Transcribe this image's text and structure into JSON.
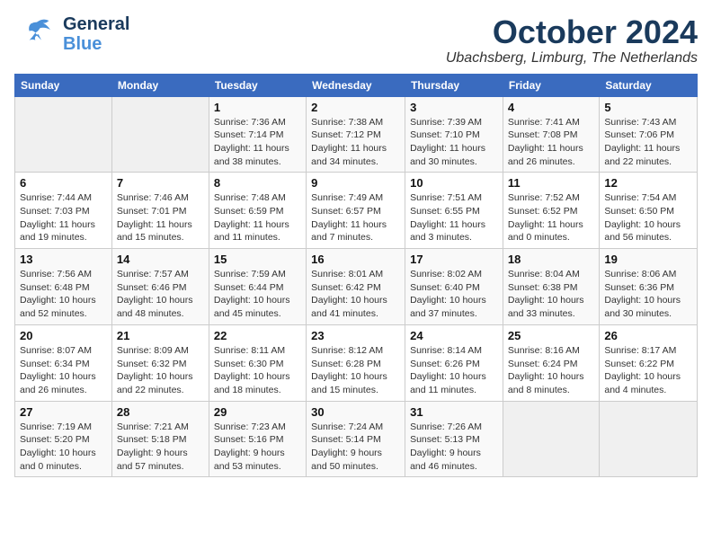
{
  "logo": {
    "general": "General",
    "blue": "Blue"
  },
  "header": {
    "month": "October 2024",
    "location": "Ubachsberg, Limburg, The Netherlands"
  },
  "weekdays": [
    "Sunday",
    "Monday",
    "Tuesday",
    "Wednesday",
    "Thursday",
    "Friday",
    "Saturday"
  ],
  "weeks": [
    [
      {
        "day": "",
        "empty": true
      },
      {
        "day": "",
        "empty": true
      },
      {
        "day": "1",
        "sunrise": "Sunrise: 7:36 AM",
        "sunset": "Sunset: 7:14 PM",
        "daylight": "Daylight: 11 hours and 38 minutes."
      },
      {
        "day": "2",
        "sunrise": "Sunrise: 7:38 AM",
        "sunset": "Sunset: 7:12 PM",
        "daylight": "Daylight: 11 hours and 34 minutes."
      },
      {
        "day": "3",
        "sunrise": "Sunrise: 7:39 AM",
        "sunset": "Sunset: 7:10 PM",
        "daylight": "Daylight: 11 hours and 30 minutes."
      },
      {
        "day": "4",
        "sunrise": "Sunrise: 7:41 AM",
        "sunset": "Sunset: 7:08 PM",
        "daylight": "Daylight: 11 hours and 26 minutes."
      },
      {
        "day": "5",
        "sunrise": "Sunrise: 7:43 AM",
        "sunset": "Sunset: 7:06 PM",
        "daylight": "Daylight: 11 hours and 22 minutes."
      }
    ],
    [
      {
        "day": "6",
        "sunrise": "Sunrise: 7:44 AM",
        "sunset": "Sunset: 7:03 PM",
        "daylight": "Daylight: 11 hours and 19 minutes."
      },
      {
        "day": "7",
        "sunrise": "Sunrise: 7:46 AM",
        "sunset": "Sunset: 7:01 PM",
        "daylight": "Daylight: 11 hours and 15 minutes."
      },
      {
        "day": "8",
        "sunrise": "Sunrise: 7:48 AM",
        "sunset": "Sunset: 6:59 PM",
        "daylight": "Daylight: 11 hours and 11 minutes."
      },
      {
        "day": "9",
        "sunrise": "Sunrise: 7:49 AM",
        "sunset": "Sunset: 6:57 PM",
        "daylight": "Daylight: 11 hours and 7 minutes."
      },
      {
        "day": "10",
        "sunrise": "Sunrise: 7:51 AM",
        "sunset": "Sunset: 6:55 PM",
        "daylight": "Daylight: 11 hours and 3 minutes."
      },
      {
        "day": "11",
        "sunrise": "Sunrise: 7:52 AM",
        "sunset": "Sunset: 6:52 PM",
        "daylight": "Daylight: 11 hours and 0 minutes."
      },
      {
        "day": "12",
        "sunrise": "Sunrise: 7:54 AM",
        "sunset": "Sunset: 6:50 PM",
        "daylight": "Daylight: 10 hours and 56 minutes."
      }
    ],
    [
      {
        "day": "13",
        "sunrise": "Sunrise: 7:56 AM",
        "sunset": "Sunset: 6:48 PM",
        "daylight": "Daylight: 10 hours and 52 minutes."
      },
      {
        "day": "14",
        "sunrise": "Sunrise: 7:57 AM",
        "sunset": "Sunset: 6:46 PM",
        "daylight": "Daylight: 10 hours and 48 minutes."
      },
      {
        "day": "15",
        "sunrise": "Sunrise: 7:59 AM",
        "sunset": "Sunset: 6:44 PM",
        "daylight": "Daylight: 10 hours and 45 minutes."
      },
      {
        "day": "16",
        "sunrise": "Sunrise: 8:01 AM",
        "sunset": "Sunset: 6:42 PM",
        "daylight": "Daylight: 10 hours and 41 minutes."
      },
      {
        "day": "17",
        "sunrise": "Sunrise: 8:02 AM",
        "sunset": "Sunset: 6:40 PM",
        "daylight": "Daylight: 10 hours and 37 minutes."
      },
      {
        "day": "18",
        "sunrise": "Sunrise: 8:04 AM",
        "sunset": "Sunset: 6:38 PM",
        "daylight": "Daylight: 10 hours and 33 minutes."
      },
      {
        "day": "19",
        "sunrise": "Sunrise: 8:06 AM",
        "sunset": "Sunset: 6:36 PM",
        "daylight": "Daylight: 10 hours and 30 minutes."
      }
    ],
    [
      {
        "day": "20",
        "sunrise": "Sunrise: 8:07 AM",
        "sunset": "Sunset: 6:34 PM",
        "daylight": "Daylight: 10 hours and 26 minutes."
      },
      {
        "day": "21",
        "sunrise": "Sunrise: 8:09 AM",
        "sunset": "Sunset: 6:32 PM",
        "daylight": "Daylight: 10 hours and 22 minutes."
      },
      {
        "day": "22",
        "sunrise": "Sunrise: 8:11 AM",
        "sunset": "Sunset: 6:30 PM",
        "daylight": "Daylight: 10 hours and 18 minutes."
      },
      {
        "day": "23",
        "sunrise": "Sunrise: 8:12 AM",
        "sunset": "Sunset: 6:28 PM",
        "daylight": "Daylight: 10 hours and 15 minutes."
      },
      {
        "day": "24",
        "sunrise": "Sunrise: 8:14 AM",
        "sunset": "Sunset: 6:26 PM",
        "daylight": "Daylight: 10 hours and 11 minutes."
      },
      {
        "day": "25",
        "sunrise": "Sunrise: 8:16 AM",
        "sunset": "Sunset: 6:24 PM",
        "daylight": "Daylight: 10 hours and 8 minutes."
      },
      {
        "day": "26",
        "sunrise": "Sunrise: 8:17 AM",
        "sunset": "Sunset: 6:22 PM",
        "daylight": "Daylight: 10 hours and 4 minutes."
      }
    ],
    [
      {
        "day": "27",
        "sunrise": "Sunrise: 7:19 AM",
        "sunset": "Sunset: 5:20 PM",
        "daylight": "Daylight: 10 hours and 0 minutes."
      },
      {
        "day": "28",
        "sunrise": "Sunrise: 7:21 AM",
        "sunset": "Sunset: 5:18 PM",
        "daylight": "Daylight: 9 hours and 57 minutes."
      },
      {
        "day": "29",
        "sunrise": "Sunrise: 7:23 AM",
        "sunset": "Sunset: 5:16 PM",
        "daylight": "Daylight: 9 hours and 53 minutes."
      },
      {
        "day": "30",
        "sunrise": "Sunrise: 7:24 AM",
        "sunset": "Sunset: 5:14 PM",
        "daylight": "Daylight: 9 hours and 50 minutes."
      },
      {
        "day": "31",
        "sunrise": "Sunrise: 7:26 AM",
        "sunset": "Sunset: 5:13 PM",
        "daylight": "Daylight: 9 hours and 46 minutes."
      },
      {
        "day": "",
        "empty": true
      },
      {
        "day": "",
        "empty": true
      }
    ]
  ]
}
